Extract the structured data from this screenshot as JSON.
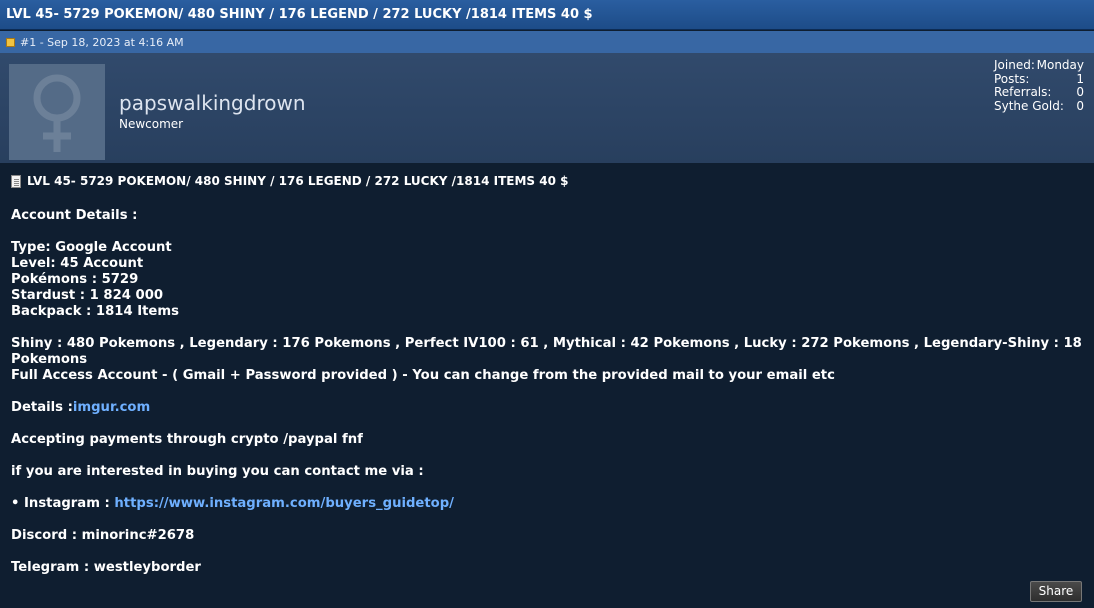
{
  "thread": {
    "title": "LVL 45- 5729 POKEMON/ 480 SHINY / 176 LEGEND / 272 LUCKY /1814 ITEMS 40 $"
  },
  "post": {
    "meta": "#1 - Sep 18, 2023 at 4:16 AM",
    "title": "LVL 45- 5729 POKEMON/ 480 SHINY / 176 LEGEND / 272 LUCKY /1814 ITEMS 40 $",
    "share_label": "Share"
  },
  "user": {
    "name": "papswalkingdrown",
    "title": "Newcomer",
    "stats": [
      {
        "label": "Joined:",
        "value": "Monday"
      },
      {
        "label": "Posts:",
        "value": "1"
      },
      {
        "label": "Referrals:",
        "value": "0"
      },
      {
        "label": "Sythe Gold:",
        "value": "0"
      }
    ]
  },
  "body": {
    "account_details_heading": "Account Details :",
    "type": "Type: Google Account",
    "level": "Level: 45 Account",
    "pokemons": "Pokémons : 5729",
    "stardust": "Stardust : 1 824 000",
    "backpack": "Backpack : 1814 Items",
    "summary": "Shiny : 480 Pokemons , Legendary : 176 Pokemons , Perfect IV100 : 61 , Mythical : 42 Pokemons , Lucky : 272 Pokemons , Legendary-Shiny : 18 Pokemons",
    "full_access": "Full Access Account - ( Gmail + Password provided ) - You can change from the provided mail to your email etc",
    "details_label": "Details :",
    "details_link": "imgur.com",
    "payments": "Accepting payments through crypto /paypal fnf",
    "contact_intro": "if you are interested in buying you can contact me via :",
    "instagram_label": "• Instagram : ",
    "instagram_link": "https://www.instagram.com/buyers_guidetop/",
    "discord": "Discord : minorinc#2678",
    "telegram": "Telegram : westleyborder"
  },
  "colors": {
    "background": "#0f1e30",
    "title_bar": "#1d4c88",
    "meta_bar": "#3867a4",
    "user_panel": "#2d4565",
    "link": "#6fb0ff"
  },
  "icons": {
    "post_icon": "post-icon",
    "doc_icon": "document-icon",
    "avatar": "female-symbol-avatar"
  }
}
